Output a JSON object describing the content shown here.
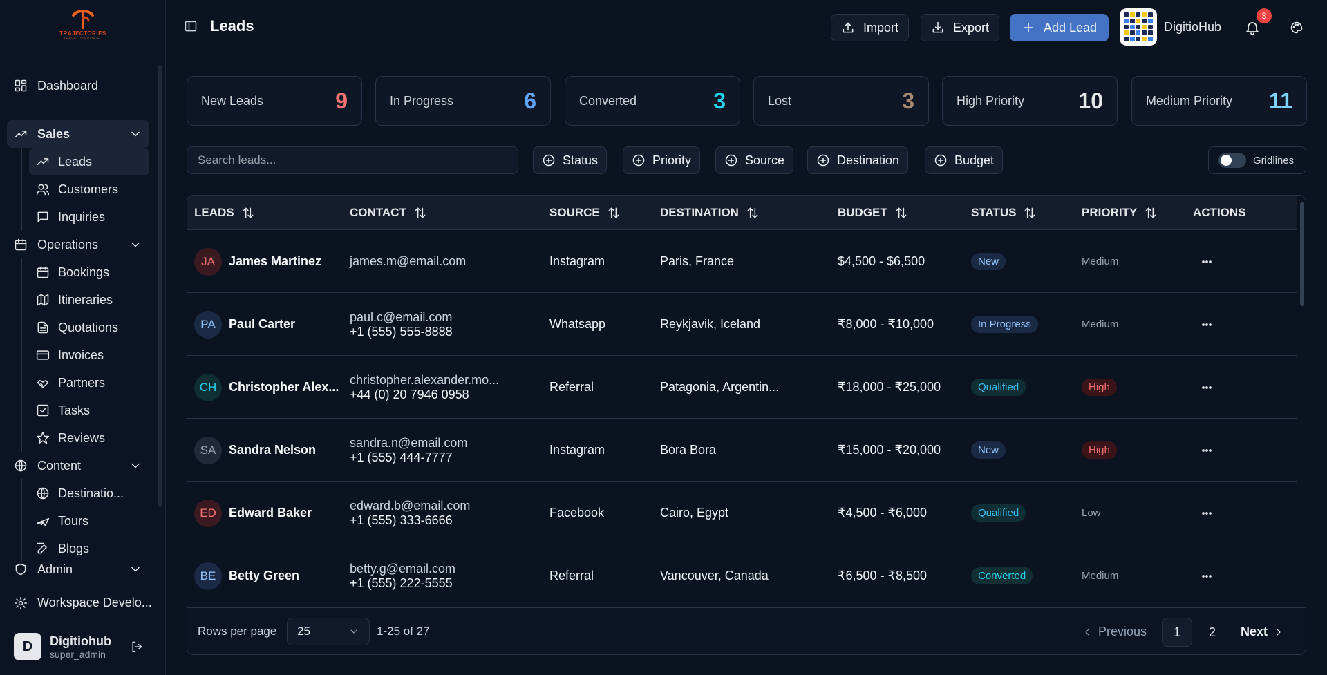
{
  "app": {
    "logo_text": "TRAJECTORIES",
    "logo_subtext": "TRAVEL SIMPLIFIED"
  },
  "sidebar": {
    "dashboard": "Dashboard",
    "sales": {
      "label": "Sales",
      "items": [
        "Leads",
        "Customers",
        "Inquiries"
      ]
    },
    "operations": {
      "label": "Operations",
      "items": [
        "Bookings",
        "Itineraries",
        "Quotations",
        "Invoices",
        "Partners",
        "Tasks",
        "Reviews"
      ]
    },
    "content": {
      "label": "Content",
      "items": [
        "Destinatio...",
        "Tours",
        "Blogs"
      ]
    },
    "admin": {
      "label": "Admin"
    },
    "workspace": "Workspace Develo...",
    "user": {
      "initial": "D",
      "name": "Digitiohub",
      "role": "super_admin"
    }
  },
  "header": {
    "title": "Leads",
    "import_label": "Import",
    "export_label": "Export",
    "add_lead_label": "Add Lead",
    "brand_name": "DigitioHub",
    "notification_count": "3"
  },
  "stats": [
    {
      "label": "New Leads",
      "value": "9",
      "color": "#f87171"
    },
    {
      "label": "In Progress",
      "value": "6",
      "color": "#60a5fa"
    },
    {
      "label": "Converted",
      "value": "3",
      "color": "#22d3ee"
    },
    {
      "label": "Lost",
      "value": "3",
      "color": "#a8896f"
    },
    {
      "label": "High Priority",
      "value": "10",
      "color": "#e5e7eb"
    },
    {
      "label": "Medium Priority",
      "value": "11",
      "color": "#7dd3fc"
    }
  ],
  "filters": {
    "search_placeholder": "Search leads...",
    "buttons": [
      "Status",
      "Priority",
      "Source",
      "Destination",
      "Budget"
    ],
    "gridlines_label": "Gridlines"
  },
  "table": {
    "columns": [
      "LEADS",
      "CONTACT",
      "SOURCE",
      "DESTINATION",
      "BUDGET",
      "STATUS",
      "PRIORITY",
      "ACTIONS"
    ],
    "rows": [
      {
        "initials": "JA",
        "name": "James Martinez",
        "email": "james.m@email.com",
        "phone": "",
        "source": "Instagram",
        "destination": "Paris, France",
        "budget": "$4,500 - $6,500",
        "status": "New",
        "priority": "Medium",
        "avatar_bg": "#3a1a20",
        "avatar_fg": "#f87171",
        "status_bg": "#1b2a44",
        "status_fg": "#93c5fd"
      },
      {
        "initials": "PA",
        "name": "Paul Carter",
        "email": "paul.c@email.com",
        "phone": "+1 (555) 555-8888",
        "source": "Whatsapp",
        "destination": "Reykjavik, Iceland",
        "budget": "₹8,000 - ₹10,000",
        "status": "In Progress",
        "priority": "Medium",
        "avatar_bg": "#1b2a44",
        "avatar_fg": "#93c5fd",
        "status_bg": "#1b2a44",
        "status_fg": "#93c5fd"
      },
      {
        "initials": "CH",
        "name": "Christopher Alex...",
        "email": "christopher.alexander.mo...",
        "phone": "+44 (0) 20 7946 0958",
        "source": "Referral",
        "destination": "Patagonia, Argentin...",
        "budget": "₹18,000 - ₹25,000",
        "status": "Qualified",
        "priority": "High",
        "avatar_bg": "#0f2f35",
        "avatar_fg": "#22d3ee",
        "status_bg": "#0f2f35",
        "status_fg": "#38bdf8"
      },
      {
        "initials": "SA",
        "name": "Sandra Nelson",
        "email": "sandra.n@email.com",
        "phone": "+1 (555) 444-7777",
        "source": "Instagram",
        "destination": "Bora Bora",
        "budget": "₹15,000 - ₹20,000",
        "status": "New",
        "priority": "High",
        "avatar_bg": "#1f2937",
        "avatar_fg": "#9ca3af",
        "status_bg": "#1b2a44",
        "status_fg": "#93c5fd"
      },
      {
        "initials": "ED",
        "name": "Edward Baker",
        "email": "edward.b@email.com",
        "phone": "+1 (555) 333-6666",
        "source": "Facebook",
        "destination": "Cairo, Egypt",
        "budget": "₹4,500 - ₹6,000",
        "status": "Qualified",
        "priority": "Low",
        "avatar_bg": "#3a1a20",
        "avatar_fg": "#f87171",
        "status_bg": "#0f2f35",
        "status_fg": "#38bdf8"
      },
      {
        "initials": "BE",
        "name": "Betty Green",
        "email": "betty.g@email.com",
        "phone": "+1 (555) 222-5555",
        "source": "Referral",
        "destination": "Vancouver, Canada",
        "budget": "₹6,500 - ₹8,500",
        "status": "Converted",
        "priority": "Medium",
        "avatar_bg": "#1b2a44",
        "avatar_fg": "#93c5fd",
        "status_bg": "#0f2f35",
        "status_fg": "#22d3ee"
      }
    ]
  },
  "pagination": {
    "rows_per_page_label": "Rows per page",
    "rows_per_page": "25",
    "range": "1-25 of 27",
    "previous": "Previous",
    "pages": [
      "1",
      "2"
    ],
    "current_page": "1",
    "next": "Next"
  }
}
